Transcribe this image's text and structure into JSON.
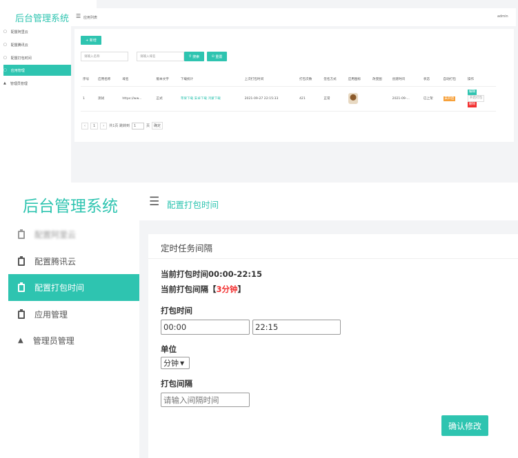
{
  "colors": {
    "accent": "#2ec4b0",
    "danger": "#f23030",
    "warning": "#f7a13b"
  },
  "top": {
    "logo": "后台管理系统",
    "breadcrumb": "应用列表",
    "user": "admin",
    "sidebar": [
      {
        "label": "配置阿里云",
        "icon": "clipboard-icon"
      },
      {
        "label": "配置腾讯云",
        "icon": "clipboard-icon"
      },
      {
        "label": "配置打包时间",
        "icon": "clipboard-icon"
      },
      {
        "label": "应用管理",
        "icon": "clipboard-icon",
        "active": true
      },
      {
        "label": "管理员管理",
        "icon": "user-icon"
      }
    ],
    "add_button": "+ 新增",
    "search_name_placeholder": "请输入名称",
    "search_domain_placeholder": "请输入域名",
    "search_button": "搜索",
    "reset_button": "重置",
    "table": {
      "headers": [
        "序号",
        "应用名称",
        "域名",
        "版本文字",
        "下载统计",
        "上次打包时间",
        "打包次数",
        "签名方式",
        "应用图标",
        "改变图",
        "创建时间",
        "状态",
        "自动打包",
        "操作"
      ],
      "rows": [
        {
          "index": "1",
          "name": "测试",
          "domain": "https://ww...",
          "version": "正式",
          "downloads": "苹果下载 安卓下载 鸿蒙下载",
          "last_pack": "2021-09-27 22:15:33",
          "pack_count": "421",
          "sign": "正常",
          "changed": "",
          "created": "2021-09-...",
          "status": "已上架",
          "auto_pack": "未开启",
          "actions": [
            "编辑",
            "开启打包",
            "删除"
          ]
        }
      ]
    },
    "pagination": {
      "prev": "‹",
      "page": "1",
      "next": "›",
      "total": "共1页 跳转到",
      "goto_value": "1",
      "page_unit": "页",
      "confirm": "确定"
    }
  },
  "bottom": {
    "logo": "后台管理系统",
    "breadcrumb": "配置打包时间",
    "sidebar": [
      {
        "label": "配置阿里云",
        "icon": "clipboard-icon"
      },
      {
        "label": "配置腾讯云",
        "icon": "clipboard-icon"
      },
      {
        "label": "配置打包时间",
        "icon": "clipboard-icon",
        "active": true
      },
      {
        "label": "应用管理",
        "icon": "clipboard-icon"
      },
      {
        "label": "管理员管理",
        "icon": "user-icon"
      }
    ],
    "card_title": "定时任务间隔",
    "current_time_label": "当前打包时间00:00-22:15",
    "current_interval_prefix": "当前打包间隔【",
    "current_interval_value": "3分钟",
    "current_interval_suffix": "】",
    "pack_time_label": "打包时间",
    "start_time": "00:00",
    "end_time": "22:15",
    "unit_label": "单位",
    "unit_selected": "分钟",
    "interval_label": "打包间隔",
    "interval_placeholder": "请输入间隔时间",
    "submit_button": "确认修改"
  }
}
